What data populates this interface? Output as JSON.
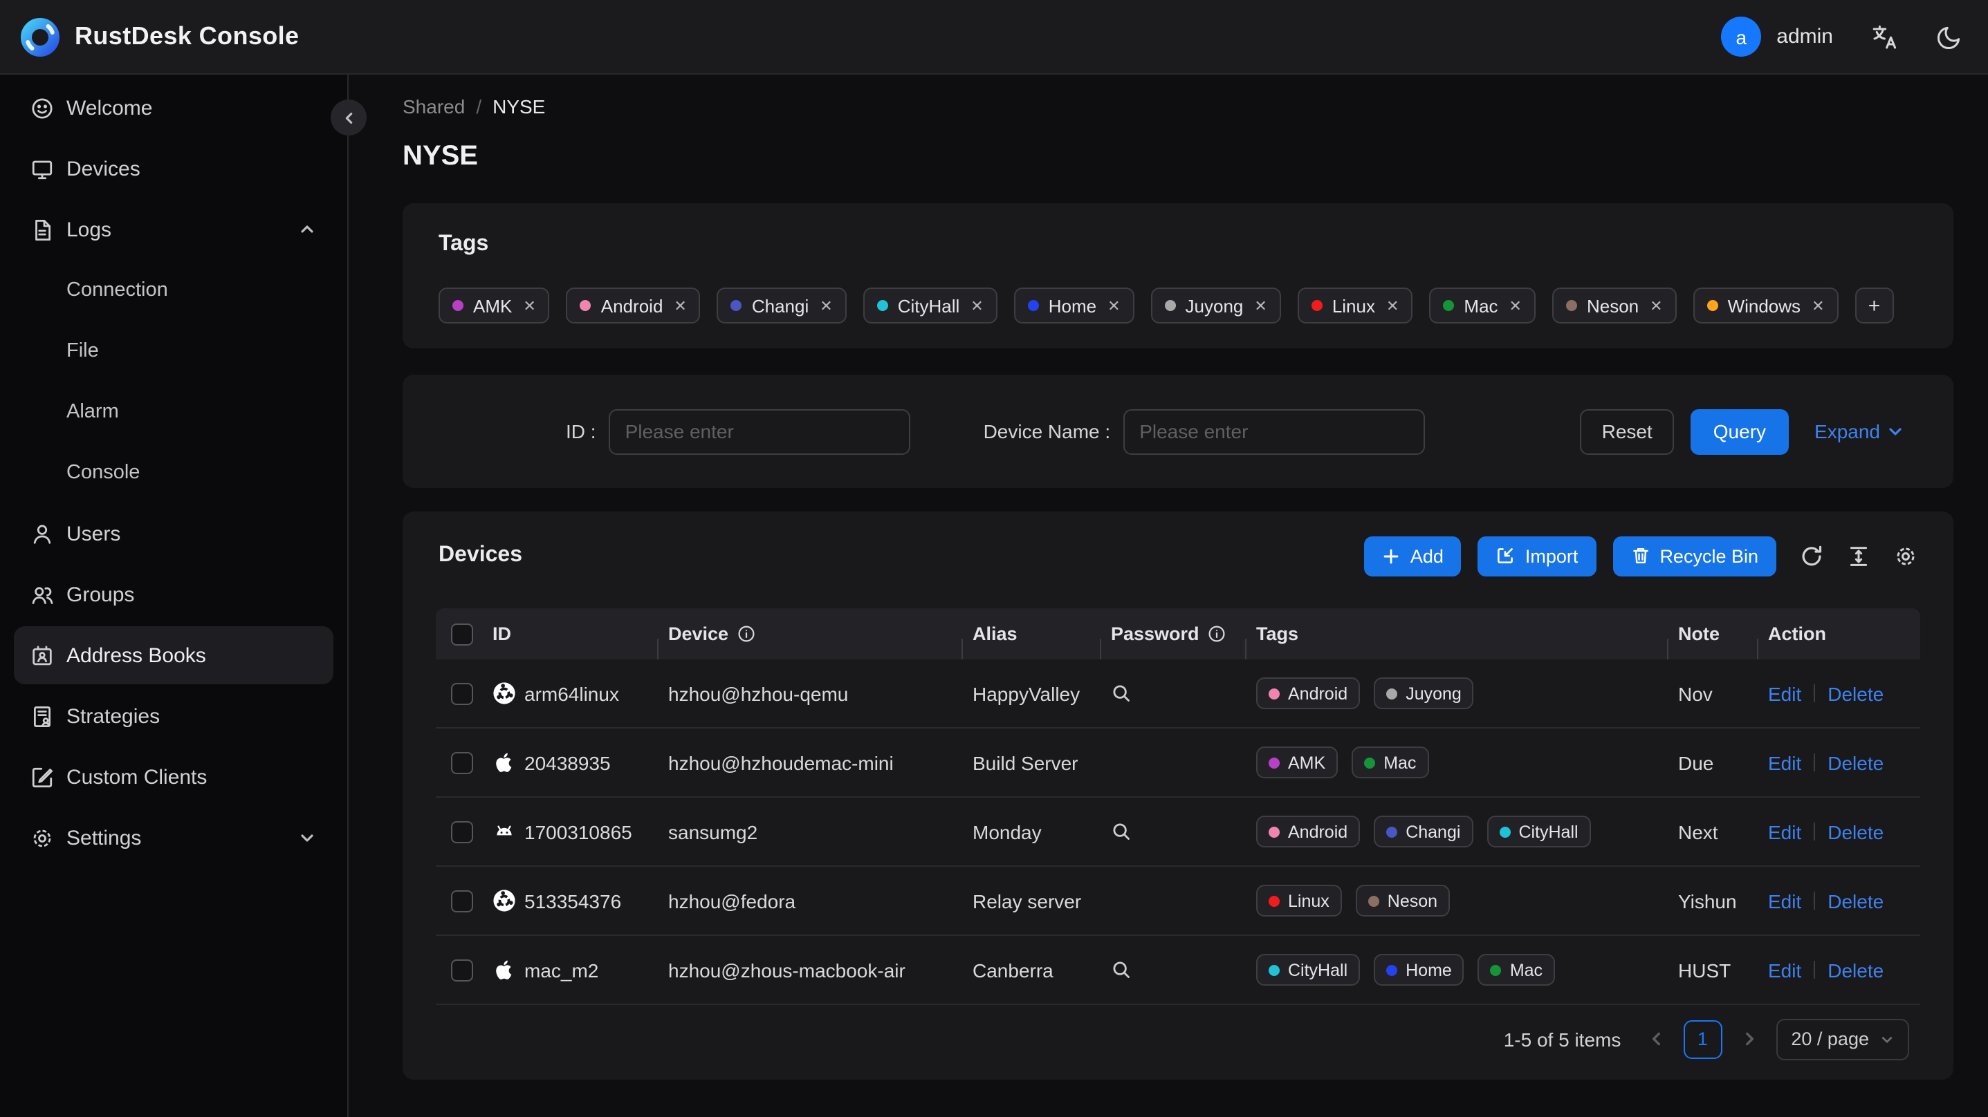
{
  "header": {
    "app_title": "RustDesk Console",
    "user_initial": "a",
    "user_name": "admin"
  },
  "sidebar": {
    "items": [
      {
        "label": "Welcome"
      },
      {
        "label": "Devices"
      },
      {
        "label": "Logs"
      },
      {
        "label": "Connection"
      },
      {
        "label": "File"
      },
      {
        "label": "Alarm"
      },
      {
        "label": "Console"
      },
      {
        "label": "Users"
      },
      {
        "label": "Groups"
      },
      {
        "label": "Address Books"
      },
      {
        "label": "Strategies"
      },
      {
        "label": "Custom Clients"
      },
      {
        "label": "Settings"
      }
    ]
  },
  "breadcrumb": {
    "parent": "Shared",
    "separator": "/",
    "current": "NYSE"
  },
  "page_title": "NYSE",
  "tags_card": {
    "title": "Tags",
    "tags": [
      "AMK",
      "Android",
      "Changi",
      "CityHall",
      "Home",
      "Juyong",
      "Linux",
      "Mac",
      "Neson",
      "Windows"
    ],
    "add_label": "+"
  },
  "tag_colors": {
    "AMK": "#b83fc6",
    "Android": "#ef85b0",
    "Changi": "#4b55c6",
    "CityHall": "#1fc2d7",
    "Home": "#2442f0",
    "Juyong": "#a8a8a8",
    "Linux": "#f21c1c",
    "Mac": "#149638",
    "Neson": "#8d6e63",
    "Windows": "#ffa41c"
  },
  "filter": {
    "id_label": "ID :",
    "device_name_label": "Device Name :",
    "placeholder": "Please enter",
    "reset_label": "Reset",
    "query_label": "Query",
    "expand_label": "Expand"
  },
  "devices_card": {
    "title": "Devices",
    "add_label": "Add",
    "import_label": "Import",
    "recycle_label": "Recycle Bin",
    "columns": [
      "ID",
      "Device",
      "Alias",
      "Password",
      "Tags",
      "Note",
      "Action"
    ],
    "actions": {
      "edit_label": "Edit",
      "delete_label": "Delete"
    },
    "rows": [
      {
        "os": "ubuntu",
        "id": "arm64linux",
        "device": "hzhou@hzhou-qemu",
        "alias": "HappyValley",
        "password_lookup": true,
        "tags": [
          "Android",
          "Juyong"
        ],
        "note": "Nov"
      },
      {
        "os": "apple",
        "id": "20438935",
        "device": "hzhou@hzhoudemac-mini",
        "alias": "Build Server",
        "password_lookup": false,
        "tags": [
          "AMK",
          "Mac"
        ],
        "note": "Due"
      },
      {
        "os": "android",
        "id": "1700310865",
        "device": "sansumg2",
        "alias": "Monday",
        "password_lookup": true,
        "tags": [
          "Android",
          "Changi",
          "CityHall"
        ],
        "note": "Next"
      },
      {
        "os": "ubuntu",
        "id": "513354376",
        "device": "hzhou@fedora",
        "alias": "Relay server",
        "password_lookup": false,
        "tags": [
          "Linux",
          "Neson"
        ],
        "note": "Yishun"
      },
      {
        "os": "apple",
        "id": "mac_m2",
        "device": "hzhou@zhous-macbook-air",
        "alias": "Canberra",
        "password_lookup": true,
        "tags": [
          "CityHall",
          "Home",
          "Mac"
        ],
        "note": "HUST"
      }
    ],
    "pagination": {
      "total_text": "1-5 of 5 items",
      "current_page": "1",
      "page_size": "20 / page"
    }
  },
  "colors": {
    "primary_button": "#1774e8",
    "link": "#3e82f0",
    "avatar": "#1677ff",
    "card_background": "#19191c"
  }
}
